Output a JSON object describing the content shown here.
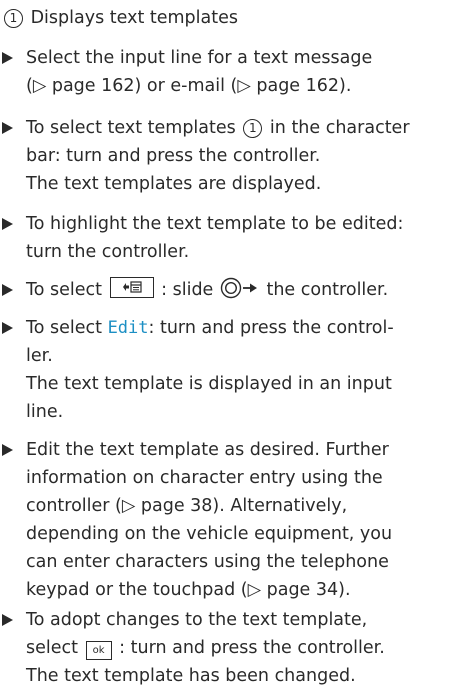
{
  "caption": {
    "marker": "1",
    "text": "Displays text templates"
  },
  "steps": [
    {
      "lines": [
        "Select the input line for a text message",
        "(▷ page 162) or e-mail (▷ page 162)."
      ]
    },
    {
      "line1_before": "To select text templates",
      "line1_marker": "1",
      "line1_after": "in the character",
      "line2": "bar: turn and press the controller.",
      "result": "The text templates are displayed."
    },
    {
      "lines": [
        "To highlight the text template to be edited:",
        "turn the controller."
      ]
    },
    {
      "before": "To select",
      "middle": ": slide",
      "after": "the controller."
    },
    {
      "before": "To select",
      "edit": "Edit",
      "after": ": turn and press the control-",
      "line2": "ler.",
      "result1": "The text template is displayed in an input",
      "result2": "line."
    },
    {
      "lines": [
        "Edit the text template as desired. Further",
        "information on character entry using the",
        "controller (▷ page 38). Alternatively,",
        "depending on the vehicle equipment, you",
        "can enter characters using the telephone",
        "keypad or the touchpad (▷ page 34)."
      ]
    },
    {
      "line1": "To adopt changes to the text template,",
      "before": "select",
      "ok": "ok",
      "after": ": turn and press the controller.",
      "result": "The text template has been changed."
    }
  ],
  "icons": {
    "bullet": "triangle-bullet-icon",
    "menu_key": "menu-key-icon",
    "controller": "controller-slide-right-icon",
    "ok_key": "ok-key-icon"
  }
}
